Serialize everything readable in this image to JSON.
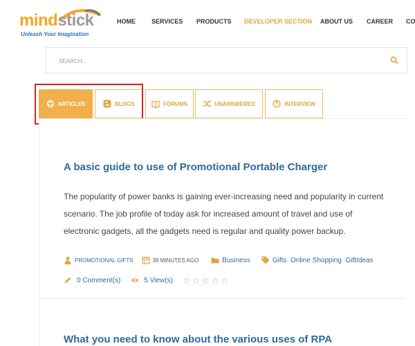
{
  "logo": {
    "part1": "mind",
    "part2": "stick",
    "tagline": "Unleash Your Imagination"
  },
  "nav": {
    "items": [
      {
        "label": "HOME"
      },
      {
        "label": "SERVICES"
      },
      {
        "label": "PRODUCTS"
      },
      {
        "label": "DEVELOPER SECTION"
      },
      {
        "label": "ABOUT US"
      },
      {
        "label": "CAREER"
      },
      {
        "label": "CO"
      }
    ]
  },
  "search": {
    "placeholder": "SEARCH..."
  },
  "tabs": [
    {
      "label": "ARTICLES",
      "icon": "articles-icon"
    },
    {
      "label": "BLOGS",
      "icon": "blogger-icon"
    },
    {
      "label": "FORUMS",
      "icon": "book-icon"
    },
    {
      "label": "UNANSWERED",
      "icon": "shuffle-icon"
    },
    {
      "label": "INTERVIEW",
      "icon": "question-icon"
    }
  ],
  "article": {
    "title": "A basic guide to use of Promotional Portable Charger",
    "body": "The popularity of power banks is gaining ever-increasing need and popularity in current scenario. The job profile of today ask for increased amount of travel and use of electronic gadgets, all the gadgets need is regular and quality power backup.",
    "author": "PROMOTIONAL GIFTS",
    "time": "39 MINUTES AGO",
    "category": "Business",
    "tags": "Gifts  Online Shopping  GiftIdeas",
    "comments": "0 Comment(s)",
    "views": "5 View(s)"
  },
  "article2": {
    "title": "What you need to know about the various uses of RPA"
  },
  "colors": {
    "accent": "#f0b04a",
    "link": "#2e6a9a",
    "highlight": "#c9232b"
  }
}
